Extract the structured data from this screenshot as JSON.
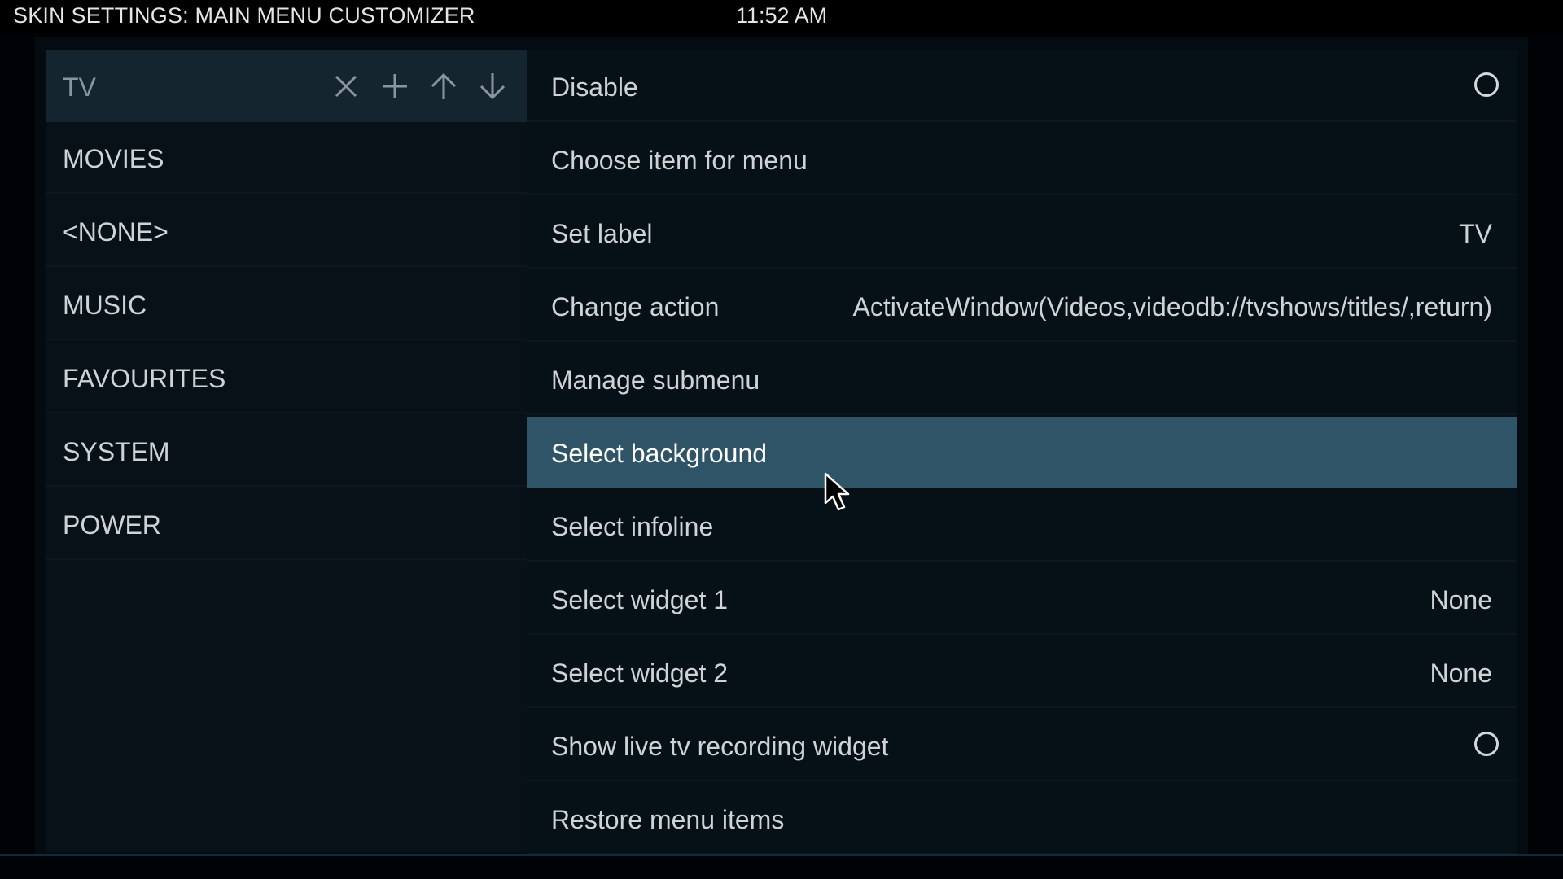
{
  "header": {
    "title": "SKIN SETTINGS: MAIN MENU CUSTOMIZER",
    "clock": "11:52 AM"
  },
  "left_menu": {
    "items": [
      {
        "label": "TV",
        "selected": true
      },
      {
        "label": "MOVIES"
      },
      {
        "label": "<NONE>"
      },
      {
        "label": "MUSIC"
      },
      {
        "label": "FAVOURITES"
      },
      {
        "label": "SYSTEM"
      },
      {
        "label": "POWER"
      }
    ],
    "controls": [
      "close-icon",
      "plus-icon",
      "arrow-up-icon",
      "arrow-down-icon"
    ]
  },
  "options": {
    "items": [
      {
        "label": "Disable",
        "type": "radio"
      },
      {
        "label": "Choose item for menu",
        "value": ""
      },
      {
        "label": "Set label",
        "value": "TV"
      },
      {
        "label": "Change action",
        "value": "ActivateWindow(Videos,videodb://tvshows/titles/,return)"
      },
      {
        "label": "Manage submenu",
        "value": ""
      },
      {
        "label": "Select background",
        "value": "",
        "focused": true
      },
      {
        "label": "Select infoline",
        "value": ""
      },
      {
        "label": "Select widget 1",
        "value": "None"
      },
      {
        "label": "Select widget 2",
        "value": "None"
      },
      {
        "label": "Show live tv recording widget",
        "type": "radio"
      },
      {
        "label": "Restore menu items",
        "value": ""
      }
    ]
  },
  "colors": {
    "focus": "#2f5367",
    "selected_left": "#14252f",
    "panel": "#040b11"
  }
}
